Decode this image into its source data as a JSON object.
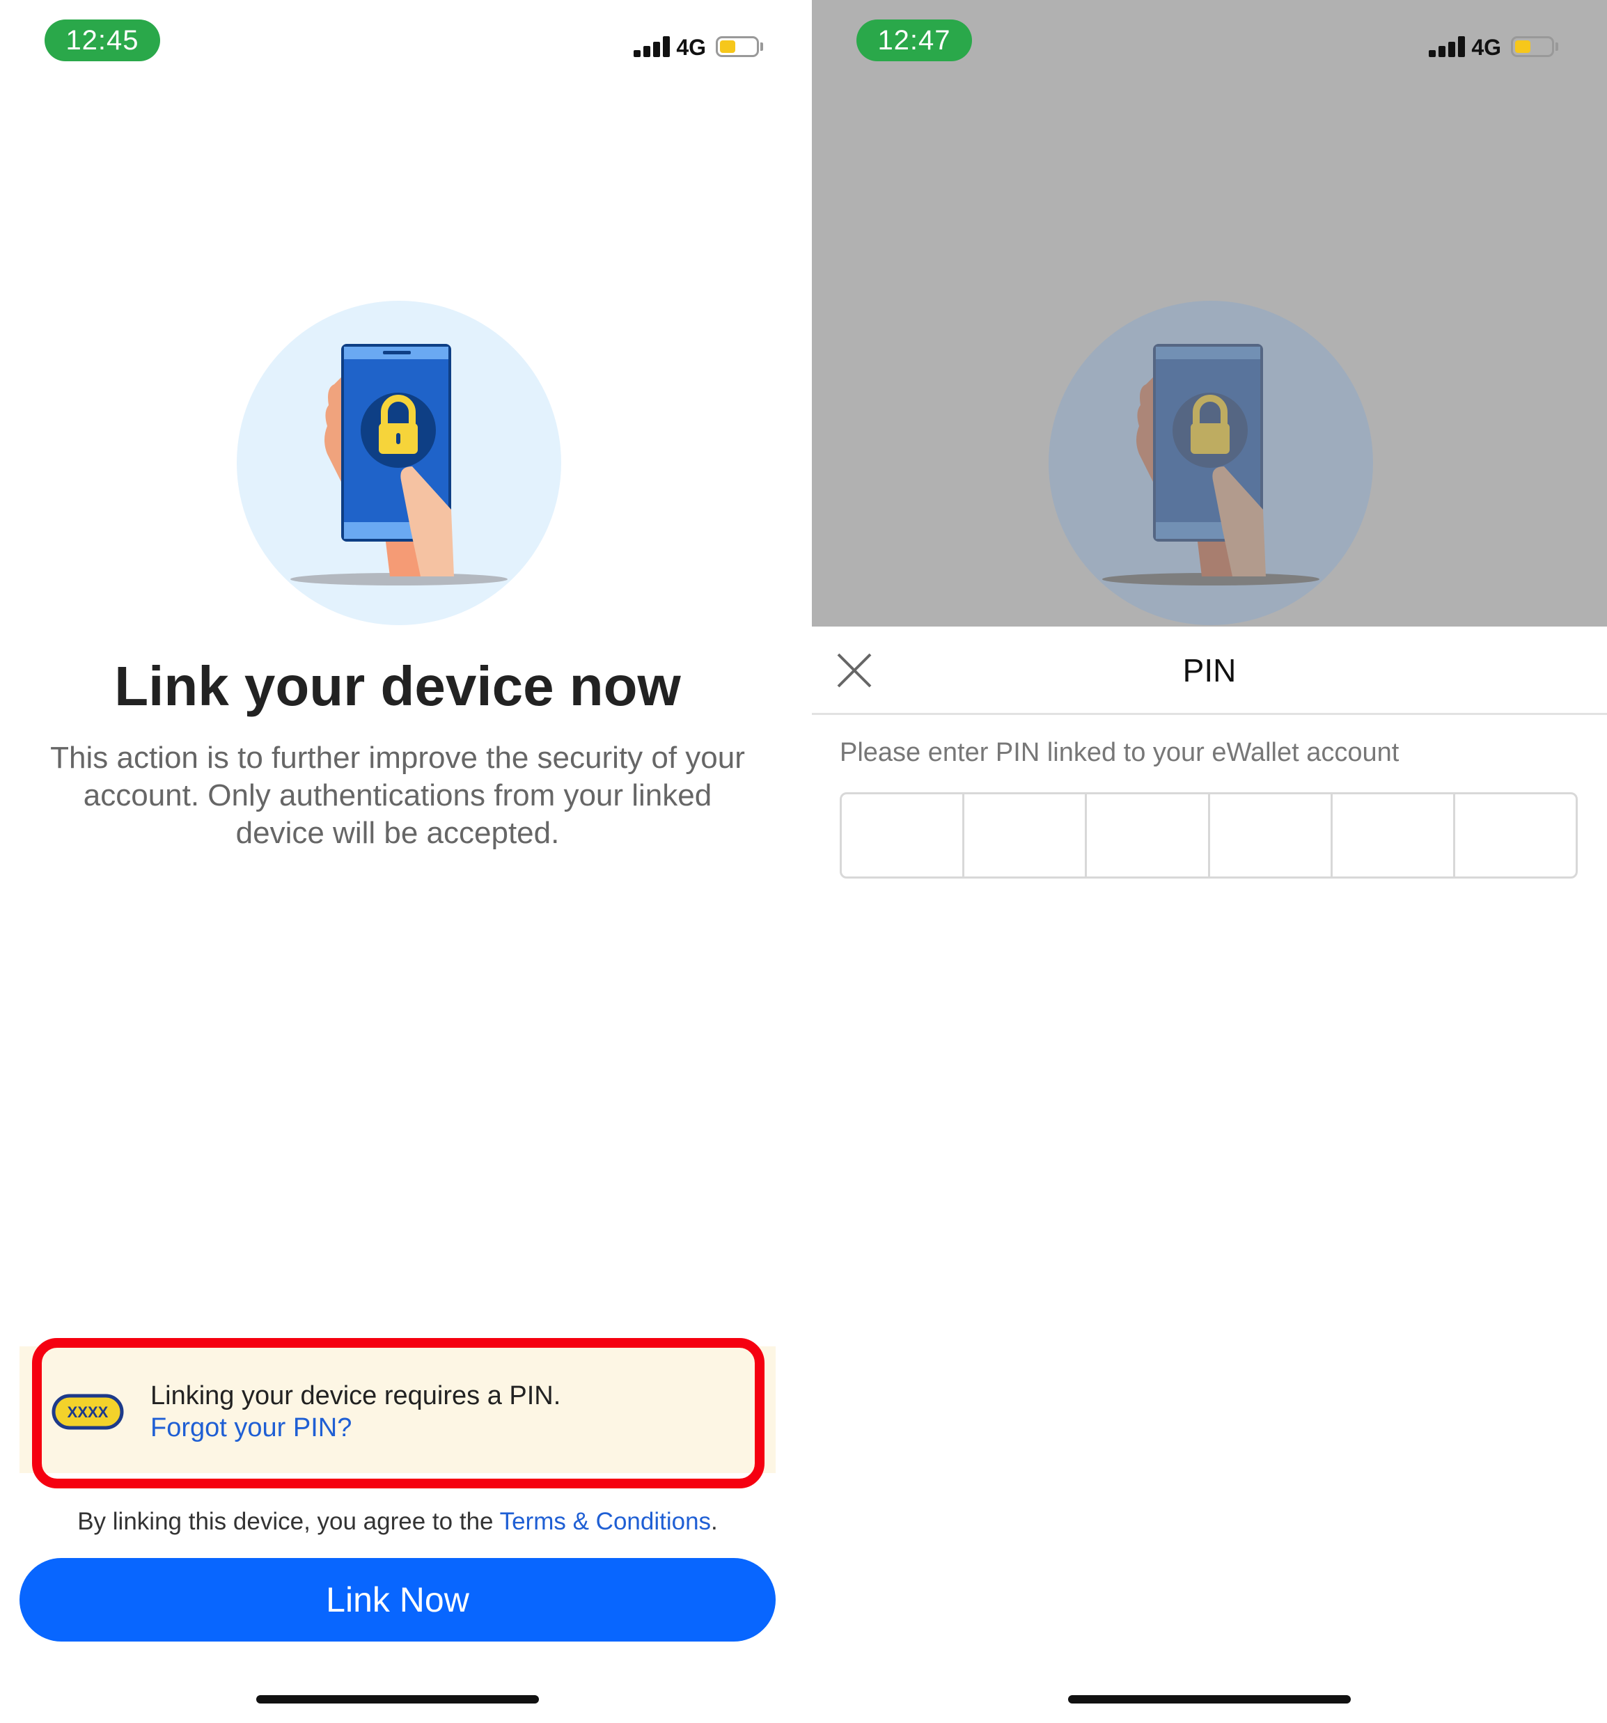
{
  "left": {
    "status": {
      "time": "12:45",
      "network": "4G"
    },
    "title": "Link your device now",
    "description": "This action is to further improve the security of your account. Only authentications from your linked device will be accepted.",
    "notice": {
      "badge": "XXXX",
      "text": "Linking your device requires a PIN.",
      "link": "Forgot your PIN?"
    },
    "terms": {
      "prefix": "By linking this device, you agree to the ",
      "link": "Terms & Conditions",
      "suffix": "."
    },
    "button": "Link Now"
  },
  "right": {
    "status": {
      "time": "12:47",
      "network": "4G"
    },
    "sheet_title": "PIN",
    "pin_label": "Please enter PIN linked to your eWallet account",
    "pin_cells": [
      "",
      "",
      "",
      "",
      "",
      ""
    ]
  },
  "colors": {
    "accent": "#0866ff",
    "link": "#1f5fd4",
    "highlight": "#f50010",
    "status_pill": "#2aa84a",
    "notice_bg": "#fdf6e4"
  },
  "icons": [
    "signal-icon",
    "battery-icon",
    "phone-lock-illustration",
    "pin-badge-icon",
    "close-icon"
  ]
}
